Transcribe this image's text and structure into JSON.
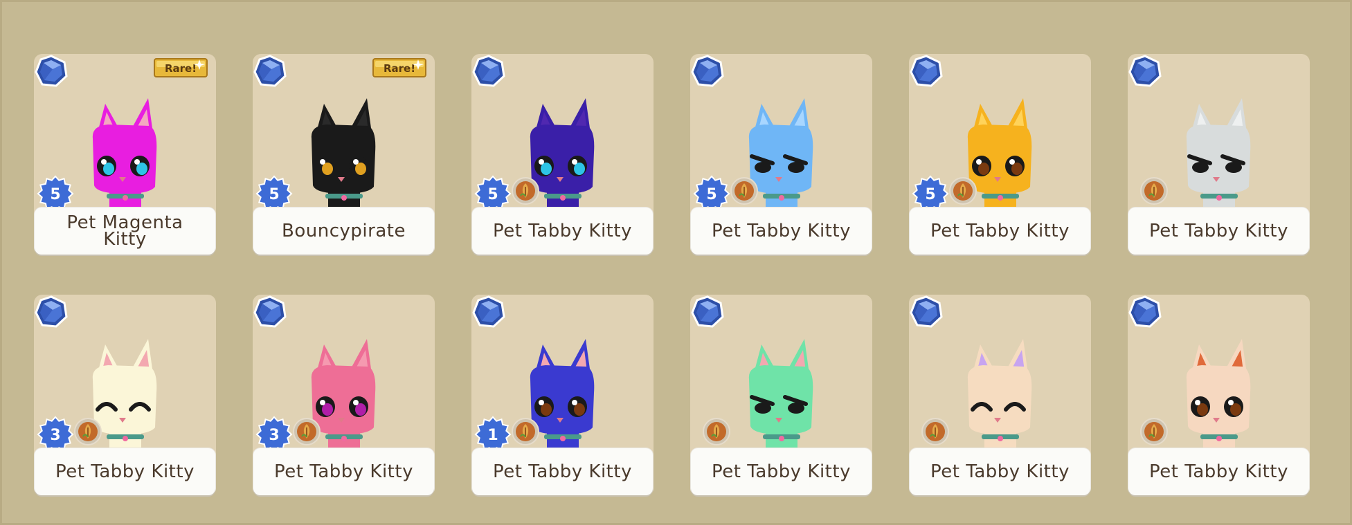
{
  "ui": {
    "colors": {
      "background": "#c5b993",
      "card": "#e0d2b4",
      "label_bg": "#fbfbf8",
      "label_text": "#4a3a2c",
      "level_badge": "#3d6bd6",
      "gem": "#3a5fbf"
    }
  },
  "pets": [
    {
      "name": "Pet Magenta Kitty",
      "rare": true,
      "rare_label": "Rare!",
      "level": "5",
      "fertilizer": false,
      "color": "#e81ee0",
      "ear": "#f3a8c0",
      "eye": "cyan",
      "icon": "magenta-kitty-icon"
    },
    {
      "name": "Bouncypirate",
      "rare": true,
      "rare_label": "Rare!",
      "level": "5",
      "fertilizer": false,
      "color": "#1a1a1a",
      "ear": "#2a2a2a",
      "eye": "gold",
      "icon": "black-kitty-icon"
    },
    {
      "name": "Pet Tabby Kitty",
      "rare": false,
      "level": "5",
      "fertilizer": true,
      "color": "#3a1fa8",
      "ear": "#5028b0",
      "eye": "cyan",
      "icon": "galaxy-kitty-icon"
    },
    {
      "name": "Pet Tabby Kitty",
      "rare": false,
      "level": "5",
      "fertilizer": true,
      "color": "#6fb6f6",
      "ear": "#a8d6ff",
      "eye": "angry",
      "icon": "ice-kitty-icon"
    },
    {
      "name": "Pet Tabby Kitty",
      "rare": false,
      "level": "5",
      "fertilizer": true,
      "color": "#f6b21e",
      "ear": "#ffd35a",
      "eye": "brown",
      "icon": "gold-kitty-icon"
    },
    {
      "name": "Pet Tabby Kitty",
      "rare": false,
      "level": "",
      "fertilizer": true,
      "color": "#d8dcdc",
      "ear": "#eef0f0",
      "eye": "angry",
      "icon": "silver-kitty-icon"
    },
    {
      "name": "Pet Tabby Kitty",
      "rare": false,
      "level": "3",
      "fertilizer": true,
      "color": "#fbf6d8",
      "ear": "#f3a8b0",
      "eye": "happy",
      "icon": "cream-kitty-icon"
    },
    {
      "name": "Pet Tabby Kitty",
      "rare": false,
      "level": "3",
      "fertilizer": true,
      "color": "#ee6e96",
      "ear": "#f59ab0",
      "eye": "magenta",
      "icon": "pink-kitty-icon"
    },
    {
      "name": "Pet Tabby Kitty",
      "rare": false,
      "level": "1",
      "fertilizer": true,
      "color": "#3a3ad0",
      "ear": "#f3a8b0",
      "eye": "brown",
      "icon": "blue-kitty-icon"
    },
    {
      "name": "Pet Tabby Kitty",
      "rare": false,
      "level": "",
      "fertilizer": true,
      "color": "#6fe3a8",
      "ear": "#f3a8b0",
      "eye": "angry",
      "icon": "mint-kitty-icon"
    },
    {
      "name": "Pet Tabby Kitty",
      "rare": false,
      "level": "",
      "fertilizer": true,
      "color": "#f6dcc0",
      "ear": "#c7a4f0",
      "eye": "happy",
      "icon": "lilac-tabby-kitty-icon"
    },
    {
      "name": "Pet Tabby Kitty",
      "rare": false,
      "level": "",
      "fertilizer": true,
      "color": "#f6d8c0",
      "ear": "#e06a3a",
      "eye": "brown",
      "icon": "orange-tabby-kitty-icon"
    }
  ]
}
